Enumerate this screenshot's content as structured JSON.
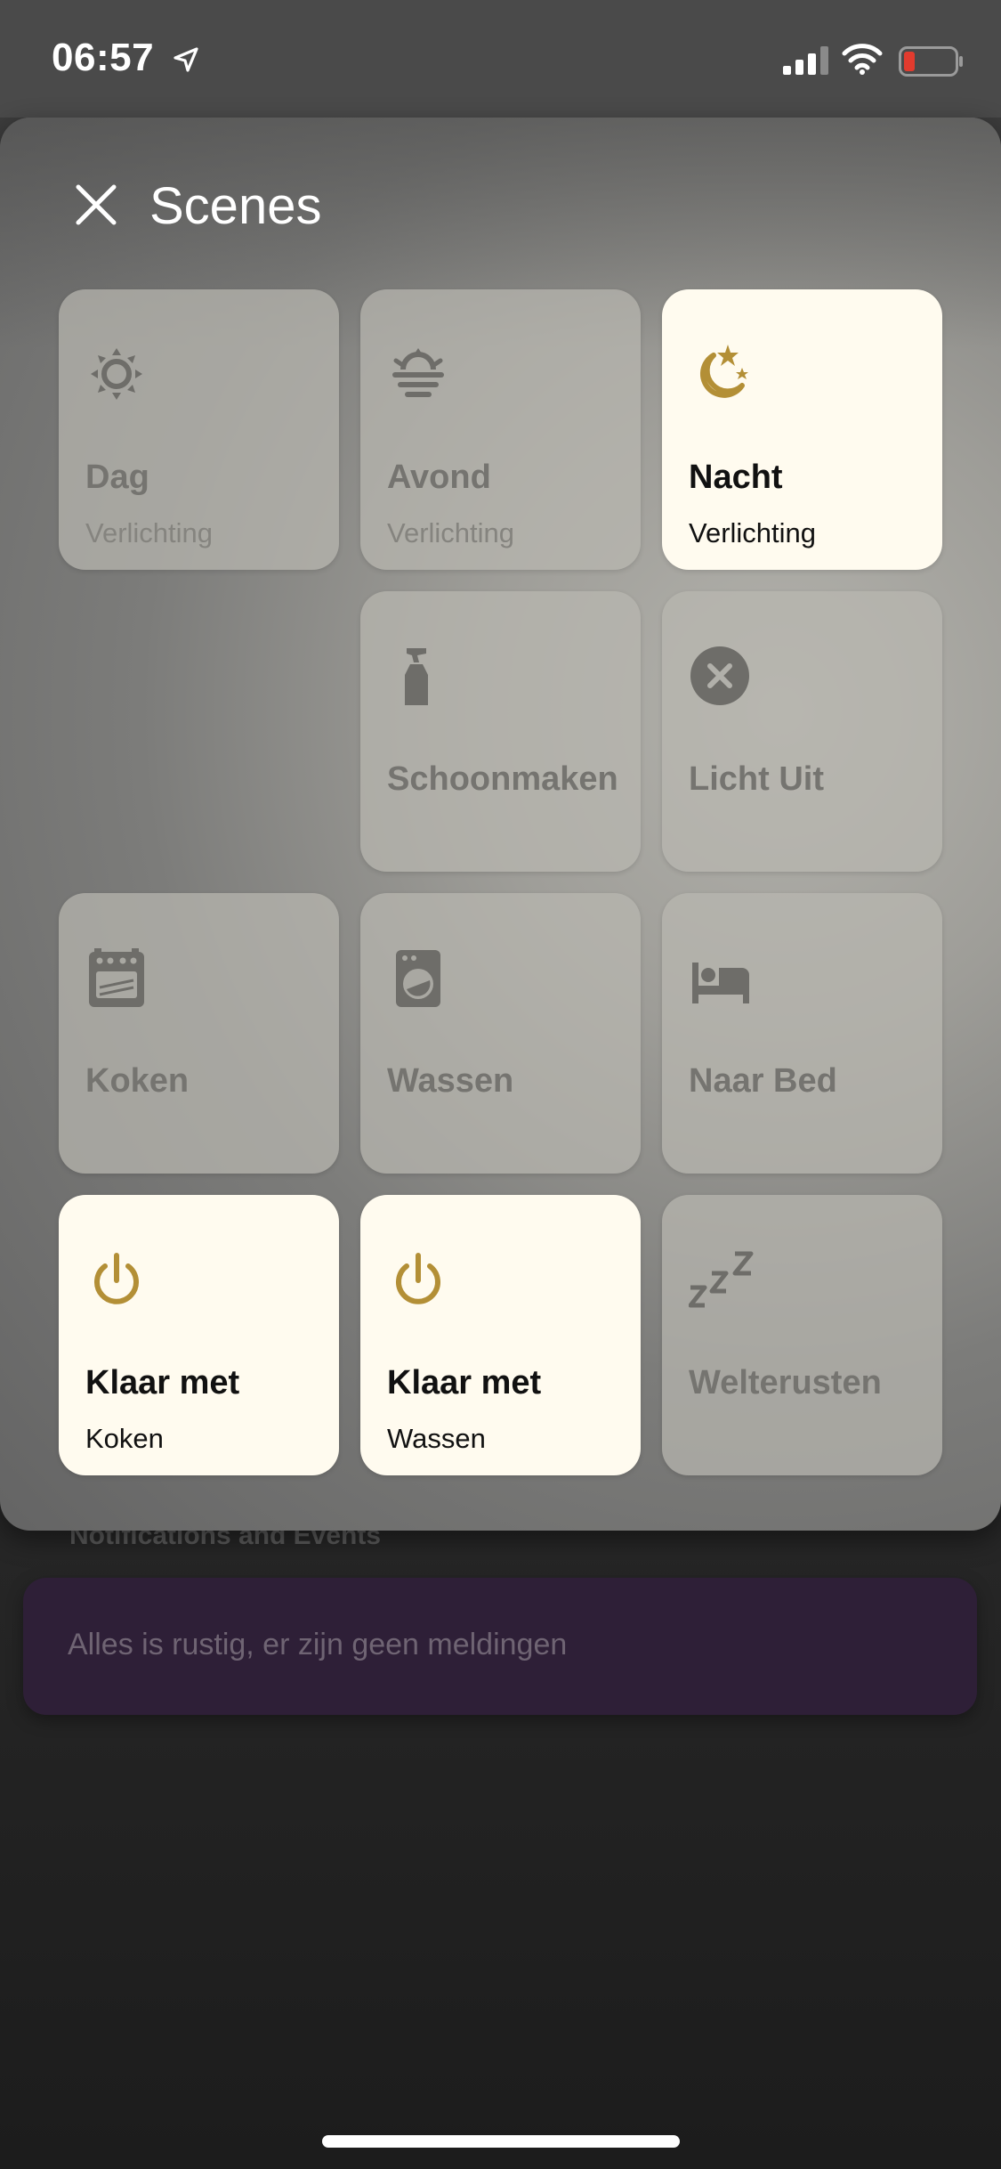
{
  "status_bar": {
    "time": "06:57"
  },
  "modal": {
    "title": "Scenes",
    "close_icon": "close-icon"
  },
  "scenes": [
    {
      "name": "Dag",
      "sub": "Verlichting",
      "icon": "sun-icon",
      "active": false
    },
    {
      "name": "Avond",
      "sub": "Verlichting",
      "icon": "sunset-icon",
      "active": false
    },
    {
      "name": "Nacht",
      "sub": "Verlichting",
      "icon": "moon-stars-icon",
      "active": true
    },
    {
      "name": "Schoonmaken",
      "sub": "",
      "icon": "spray-bottle-icon",
      "active": false
    },
    {
      "name": "Licht Uit",
      "sub": "",
      "icon": "close-circle-icon",
      "active": false
    },
    {
      "name": "Koken",
      "sub": "",
      "icon": "stove-icon",
      "active": false
    },
    {
      "name": "Wassen",
      "sub": "",
      "icon": "washing-machine-icon",
      "active": false
    },
    {
      "name": "Naar Bed",
      "sub": "",
      "icon": "bed-icon",
      "active": false
    },
    {
      "name": "Klaar met",
      "sub": "Koken",
      "icon": "power-icon",
      "active": true
    },
    {
      "name": "Klaar met",
      "sub": "Wassen",
      "icon": "power-icon",
      "active": true
    },
    {
      "name": "Welterusten",
      "sub": "",
      "icon": "sleep-zzz-icon",
      "active": false
    }
  ],
  "background": {
    "section_title": "Notifications and Events",
    "notification_text": "Alles is rustig, er zijn geen meldingen"
  },
  "colors": {
    "active_tile": "#fffbef",
    "active_icon": "#b38f36",
    "inactive_icon": "#6e6d69",
    "notification_card": "#2e1f37"
  }
}
